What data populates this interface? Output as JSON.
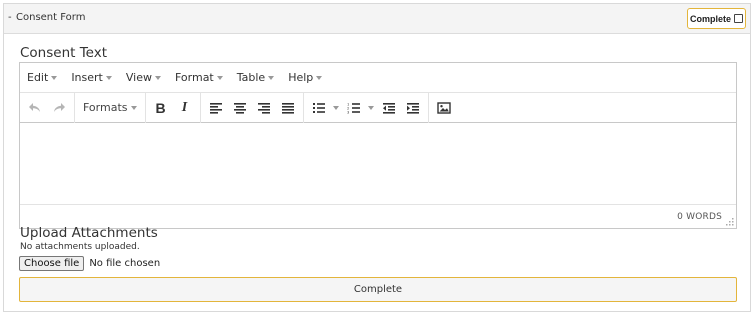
{
  "panel": {
    "collapse_symbol": "-",
    "title": "Consent Form",
    "complete_toggle_label": "Complete",
    "complete_checked": false
  },
  "consent_section": {
    "label": "Consent Text",
    "menubar": [
      {
        "label": "Edit"
      },
      {
        "label": "Insert"
      },
      {
        "label": "View"
      },
      {
        "label": "Format"
      },
      {
        "label": "Table"
      },
      {
        "label": "Help"
      }
    ],
    "toolbar": {
      "formats_label": "Formats",
      "bold_glyph": "B",
      "italic_glyph": "I",
      "icons": [
        "undo-icon",
        "redo-icon",
        "bold-icon",
        "italic-icon",
        "align-left-icon",
        "align-center-icon",
        "align-right-icon",
        "align-justify-icon",
        "bullet-list-icon",
        "numbered-list-icon",
        "outdent-icon",
        "indent-icon",
        "image-icon"
      ]
    },
    "content": "",
    "word_count": "0 WORDS"
  },
  "upload_section": {
    "label": "Upload Attachments",
    "status": "No attachments uploaded.",
    "choose_file_label": "Choose file",
    "no_file_text": "No file chosen"
  },
  "complete_button_label": "Complete",
  "colors": {
    "accent_border": "#e3b53b",
    "header_bg": "#f4f4f4",
    "panel_border": "#d9d9d9"
  }
}
